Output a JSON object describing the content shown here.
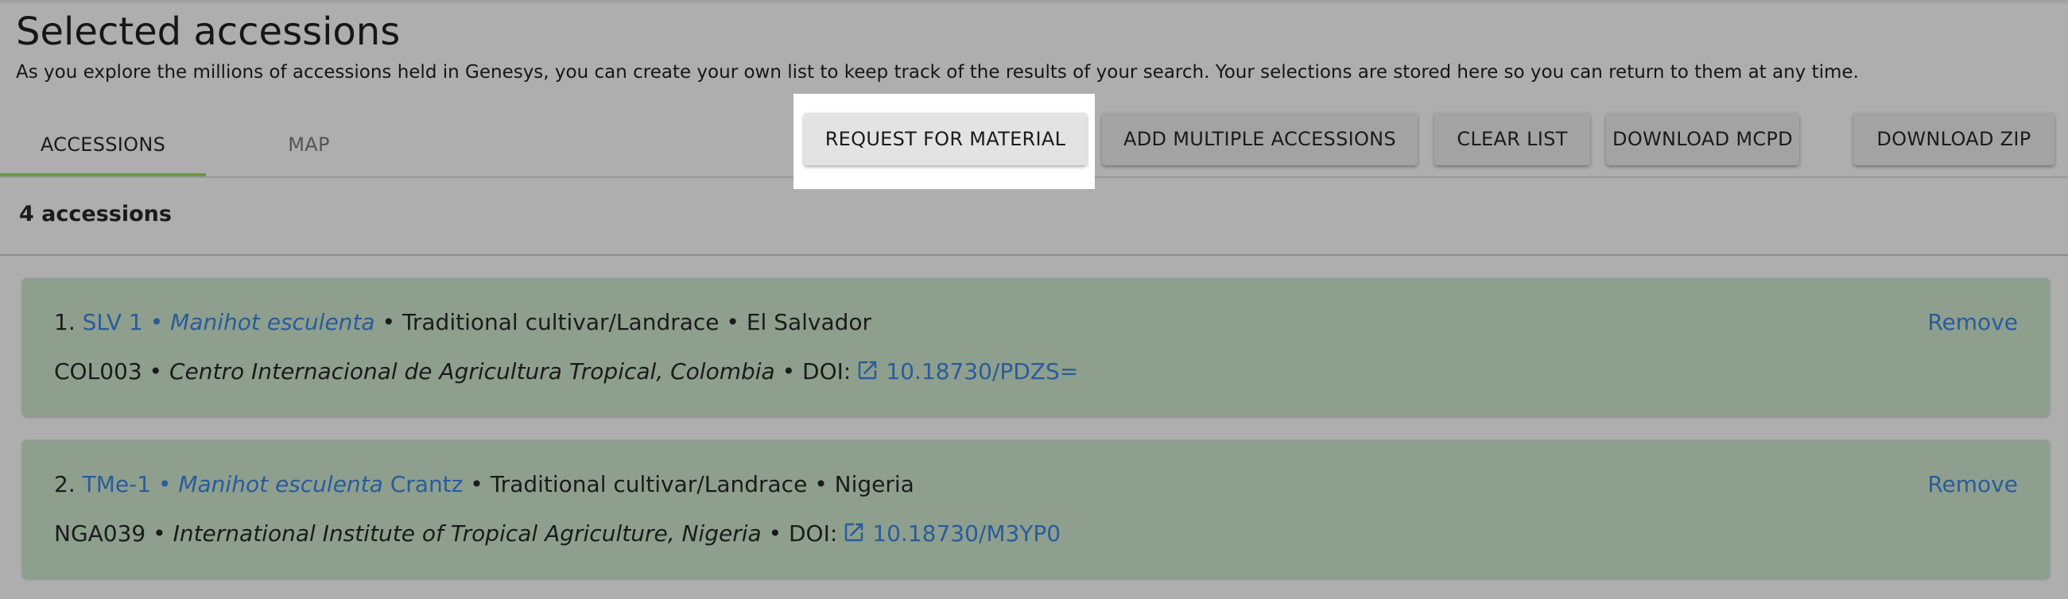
{
  "page": {
    "title": "Selected accessions",
    "intro": "As you explore the millions of accessions held in Genesys, you can create your own list to keep track of the results of your search. Your selections are stored here so you can return to them at any time."
  },
  "tabs": [
    {
      "label": "ACCESSIONS",
      "active": true
    },
    {
      "label": "MAP",
      "active": false
    }
  ],
  "actions": {
    "request": "REQUEST FOR MATERIAL",
    "add_multiple": "ADD MULTIPLE ACCESSIONS",
    "clear": "CLEAR LIST",
    "download_mcpd": "DOWNLOAD MCPD",
    "download_zip": "DOWNLOAD ZIP"
  },
  "count_label": "4 accessions",
  "accessions": [
    {
      "index": "1.",
      "id": "SLV 1",
      "sep": "•",
      "taxon": "Manihot esculenta",
      "authority": "",
      "type": "• Traditional cultivar/Landrace • El Salvador",
      "institute_code": "COL003 •",
      "institute_name": "Centro Internacional de Agricultura Tropical, Colombia",
      "doi_label": "• DOI:",
      "doi": "10.18730/PDZS=",
      "remove": "Remove"
    },
    {
      "index": "2.",
      "id": "TMe-1",
      "sep": "•",
      "taxon": "Manihot esculenta",
      "authority": "Crantz",
      "type": "• Traditional cultivar/Landrace • Nigeria",
      "institute_code": "NGA039 •",
      "institute_name": "International Institute of Tropical Agriculture, Nigeria",
      "doi_label": "• DOI:",
      "doi": "10.18730/M3YP0",
      "remove": "Remove"
    }
  ],
  "icons": {
    "doi_link": "external-link-icon"
  },
  "colors": {
    "link": "#2a5c9a",
    "card": "#8e9f8e",
    "tab_indicator": "#6a9a48",
    "highlight": "#ffffff"
  }
}
